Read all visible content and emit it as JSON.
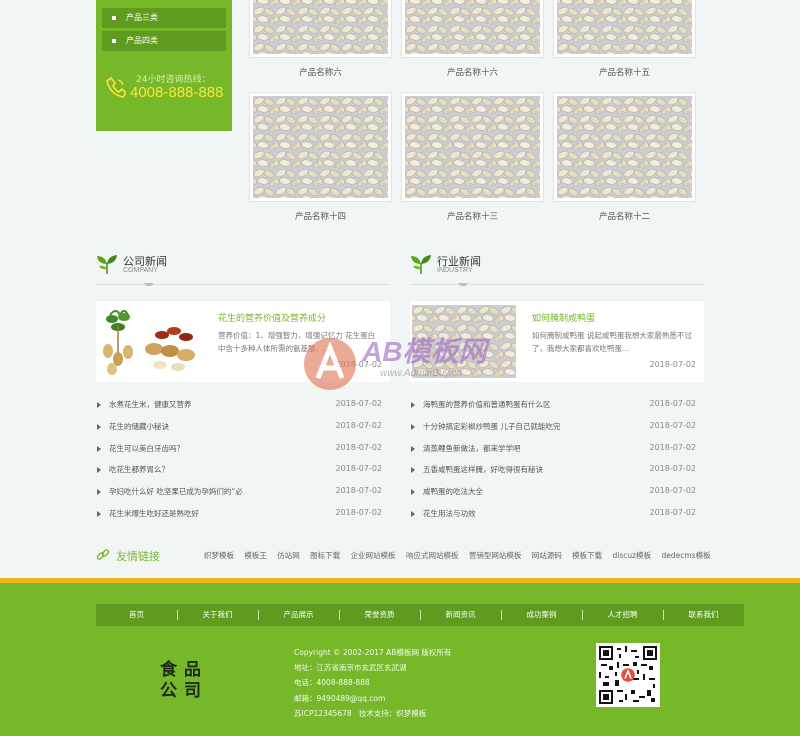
{
  "sidebar": {
    "categories": [
      "产品三类",
      "产品四类"
    ],
    "hotline_label": "24小时咨询热线：",
    "hotline_number": "4008-888-888"
  },
  "products": [
    {
      "name": "产品名称六"
    },
    {
      "name": "产品名称十六"
    },
    {
      "name": "产品名称十五"
    },
    {
      "name": "产品名称十四"
    },
    {
      "name": "产品名称十三"
    },
    {
      "name": "产品名称十二"
    }
  ],
  "company_news": {
    "title": "公司新闻",
    "subtitle": "COMPANY",
    "featured": {
      "title": "花生的营养价值及营养成分",
      "summary": "营养价值：1、增强智力，增强记忆力 花生蛋白中含十多种人体所需的氨基酸，...",
      "date": "2018-07-02"
    },
    "items": [
      {
        "title": "水煮花生米，健康又营养",
        "date": "2018-07-02"
      },
      {
        "title": "花生的储藏小秘诀",
        "date": "2018-07-02"
      },
      {
        "title": "花生可以美白牙齿吗？",
        "date": "2018-07-02"
      },
      {
        "title": "吃花生都养胃么？",
        "date": "2018-07-02"
      },
      {
        "title": "孕妇吃什么好 吃坚果已成为孕妈们的“必",
        "date": "2018-07-02"
      },
      {
        "title": "花生米爆生吃好还是熟吃好",
        "date": "2018-07-02"
      }
    ]
  },
  "industry_news": {
    "title": "行业新闻",
    "subtitle": "INDUSTRY",
    "featured": {
      "title": "如何腌制咸鸭蛋",
      "summary": "如何腌制咸鸭蛋 说起咸鸭蛋我想大家最熟悉不过了，我想大家都喜欢吃鸭蛋...",
      "date": "2018-07-02"
    },
    "items": [
      {
        "title": "海鸭蛋的营养价值和普通鸭蛋有什么区",
        "date": "2018-07-02"
      },
      {
        "title": "十分钟搞定彩椒炒鸭蛋 儿子自己就能吃完",
        "date": "2018-07-02"
      },
      {
        "title": "清蒸鲤鱼新做法，都来学学吧",
        "date": "2018-07-02"
      },
      {
        "title": "五香咸鸭蛋这样腌，好吃得很有秘诀",
        "date": "2018-07-02"
      },
      {
        "title": "咸鸭蛋的吃法大全",
        "date": "2018-07-02"
      },
      {
        "title": "花生用法与功效",
        "date": "2018-07-02"
      }
    ]
  },
  "links": {
    "title": "友情链接",
    "items": [
      "织梦模板",
      "模板王",
      "仿站网",
      "图标下载",
      "企业网站模板",
      "响应式网站模板",
      "营销型网站模板",
      "网站源码",
      "模板下载",
      "discuz模板",
      "dedecms模板"
    ]
  },
  "footer": {
    "nav": [
      "首页",
      "关于我们",
      "产品展示",
      "荣誉资质",
      "新闻资讯",
      "成功案例",
      "人才招聘",
      "联系我们"
    ],
    "logo_line1": "食品",
    "logo_line2": "公司",
    "copyright": "Copyright © 2002-2017 AB模板网 版权所有",
    "address": "地址：江苏省南京市玄武区玄武湖",
    "phone": "电话：4008-888-888",
    "email": "邮箱：9490489@qq.com",
    "icp": "苏ICP12345678",
    "support": "技术支持：织梦模板"
  },
  "watermark": {
    "text": "AB模板网",
    "url": "www.AdminBuy.cn"
  },
  "colors": {
    "brand_green": "#76b82a",
    "dark_green": "#5e9b1e",
    "hotline_yellow": "#ffe33b",
    "accent_bar": "#f0b51d"
  }
}
